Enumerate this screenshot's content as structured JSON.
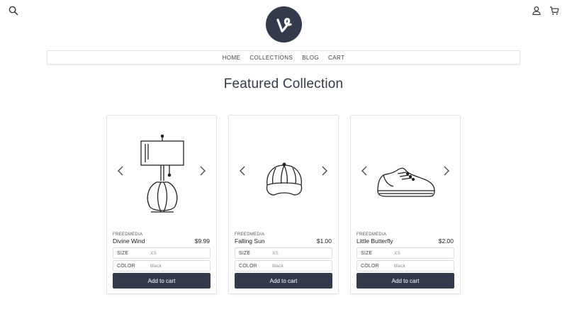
{
  "header": {
    "icons": {
      "search": "search-icon",
      "account": "user-icon",
      "cart": "cart-icon"
    },
    "logo_icon": "vine-logo",
    "logo_color": "#323a4c"
  },
  "nav": {
    "items": [
      {
        "label": "HOME"
      },
      {
        "label": "COLLECTIONS"
      },
      {
        "label": "BLOG"
      },
      {
        "label": "CART"
      }
    ]
  },
  "main": {
    "title": "Featured Collection",
    "products": [
      {
        "image_icon": "lamp-icon",
        "vendor": "FREEDMEDIA",
        "name": "Divine Wind",
        "price": "$9.99",
        "size_label": "SIZE",
        "size_value": "XS",
        "color_label": "COLOR",
        "color_value": "Black",
        "button_label": "Add to cart"
      },
      {
        "image_icon": "cap-icon",
        "vendor": "FREEDMEDIA",
        "name": "Falling Sun",
        "price": "$1.00",
        "size_label": "SIZE",
        "size_value": "XS",
        "color_label": "COLOR",
        "color_value": "Black",
        "button_label": "Add to cart"
      },
      {
        "image_icon": "sneaker-icon",
        "vendor": "FREEDMEDIA",
        "name": "Little Butterfly",
        "price": "$2.00",
        "size_label": "SIZE",
        "size_value": "XS",
        "color_label": "COLOR",
        "color_value": "Black",
        "button_label": "Add to cart"
      }
    ]
  },
  "colors": {
    "accent": "#323a4c",
    "border": "#e3e3e3",
    "text": "#333a47"
  }
}
